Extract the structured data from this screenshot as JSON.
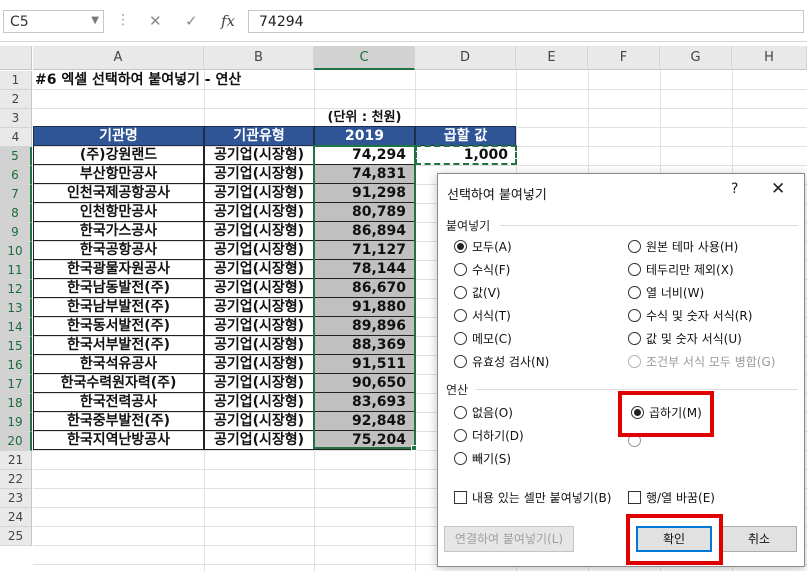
{
  "formula_bar": {
    "name_box": "C5",
    "cancel_icon": "✕",
    "enter_icon": "✓",
    "fx_label": "fx",
    "value": "74294"
  },
  "columns": [
    "A",
    "B",
    "C",
    "D",
    "E",
    "F",
    "G",
    "H"
  ],
  "rows": [
    "1",
    "2",
    "3",
    "4",
    "5",
    "6",
    "7",
    "8",
    "9",
    "10",
    "11",
    "12",
    "13",
    "14",
    "15",
    "16",
    "17",
    "18",
    "19",
    "20",
    "21",
    "22",
    "23",
    "24",
    "25"
  ],
  "sheet": {
    "title": "#6 엑셀 선택하여 붙여넣기 - 연산",
    "unit_note": "(단위 : 천원)",
    "headers": [
      "기관명",
      "기관유형",
      "2019",
      "곱할 값"
    ],
    "multiplier": "1,000",
    "records": [
      {
        "name": "(주)강원랜드",
        "type": "공기업(시장형)",
        "value": "74,294"
      },
      {
        "name": "부산항만공사",
        "type": "공기업(시장형)",
        "value": "74,831"
      },
      {
        "name": "인천국제공항공사",
        "type": "공기업(시장형)",
        "value": "91,298"
      },
      {
        "name": "인천항만공사",
        "type": "공기업(시장형)",
        "value": "80,789"
      },
      {
        "name": "한국가스공사",
        "type": "공기업(시장형)",
        "value": "86,894"
      },
      {
        "name": "한국공항공사",
        "type": "공기업(시장형)",
        "value": "71,127"
      },
      {
        "name": "한국광물자원공사",
        "type": "공기업(시장형)",
        "value": "78,144"
      },
      {
        "name": "한국남동발전(주)",
        "type": "공기업(시장형)",
        "value": "86,670"
      },
      {
        "name": "한국남부발전(주)",
        "type": "공기업(시장형)",
        "value": "91,880"
      },
      {
        "name": "한국동서발전(주)",
        "type": "공기업(시장형)",
        "value": "89,896"
      },
      {
        "name": "한국서부발전(주)",
        "type": "공기업(시장형)",
        "value": "88,369"
      },
      {
        "name": "한국석유공사",
        "type": "공기업(시장형)",
        "value": "91,511"
      },
      {
        "name": "한국수력원자력(주)",
        "type": "공기업(시장형)",
        "value": "90,650"
      },
      {
        "name": "한국전력공사",
        "type": "공기업(시장형)",
        "value": "83,693"
      },
      {
        "name": "한국중부발전(주)",
        "type": "공기업(시장형)",
        "value": "92,848"
      },
      {
        "name": "한국지역난방공사",
        "type": "공기업(시장형)",
        "value": "75,204"
      }
    ]
  },
  "dialog": {
    "title": "선택하여 붙여넣기",
    "help": "?",
    "close": "✕",
    "paste_section": "붙여넣기",
    "paste_left": [
      {
        "label": "모두(A)",
        "checked": true
      },
      {
        "label": "수식(F)",
        "checked": false
      },
      {
        "label": "값(V)",
        "checked": false
      },
      {
        "label": "서식(T)",
        "checked": false
      },
      {
        "label": "메모(C)",
        "checked": false
      },
      {
        "label": "유효성 검사(N)",
        "checked": false
      }
    ],
    "paste_right": [
      {
        "label": "원본 테마 사용(H)",
        "checked": false,
        "disabled": false
      },
      {
        "label": "테두리만 제외(X)",
        "checked": false,
        "disabled": false
      },
      {
        "label": "열 너비(W)",
        "checked": false,
        "disabled": false
      },
      {
        "label": "수식 및 숫자 서식(R)",
        "checked": false,
        "disabled": false
      },
      {
        "label": "값 및 숫자 서식(U)",
        "checked": false,
        "disabled": false
      },
      {
        "label": "조건부 서식 모두 병합(G)",
        "checked": false,
        "disabled": true
      }
    ],
    "operation_section": "연산",
    "op_left": [
      {
        "label": "없음(O)",
        "checked": false
      },
      {
        "label": "더하기(D)",
        "checked": false
      },
      {
        "label": "빼기(S)",
        "checked": false
      }
    ],
    "op_multiply": {
      "label": "곱하기(M)",
      "checked": true
    },
    "skip_blanks": "내용 있는 셀만 붙여넣기(B)",
    "transpose": "행/열 바꿈(E)",
    "paste_link": "연결하여 붙여넣기(L)",
    "ok": "확인",
    "cancel": "취소"
  }
}
